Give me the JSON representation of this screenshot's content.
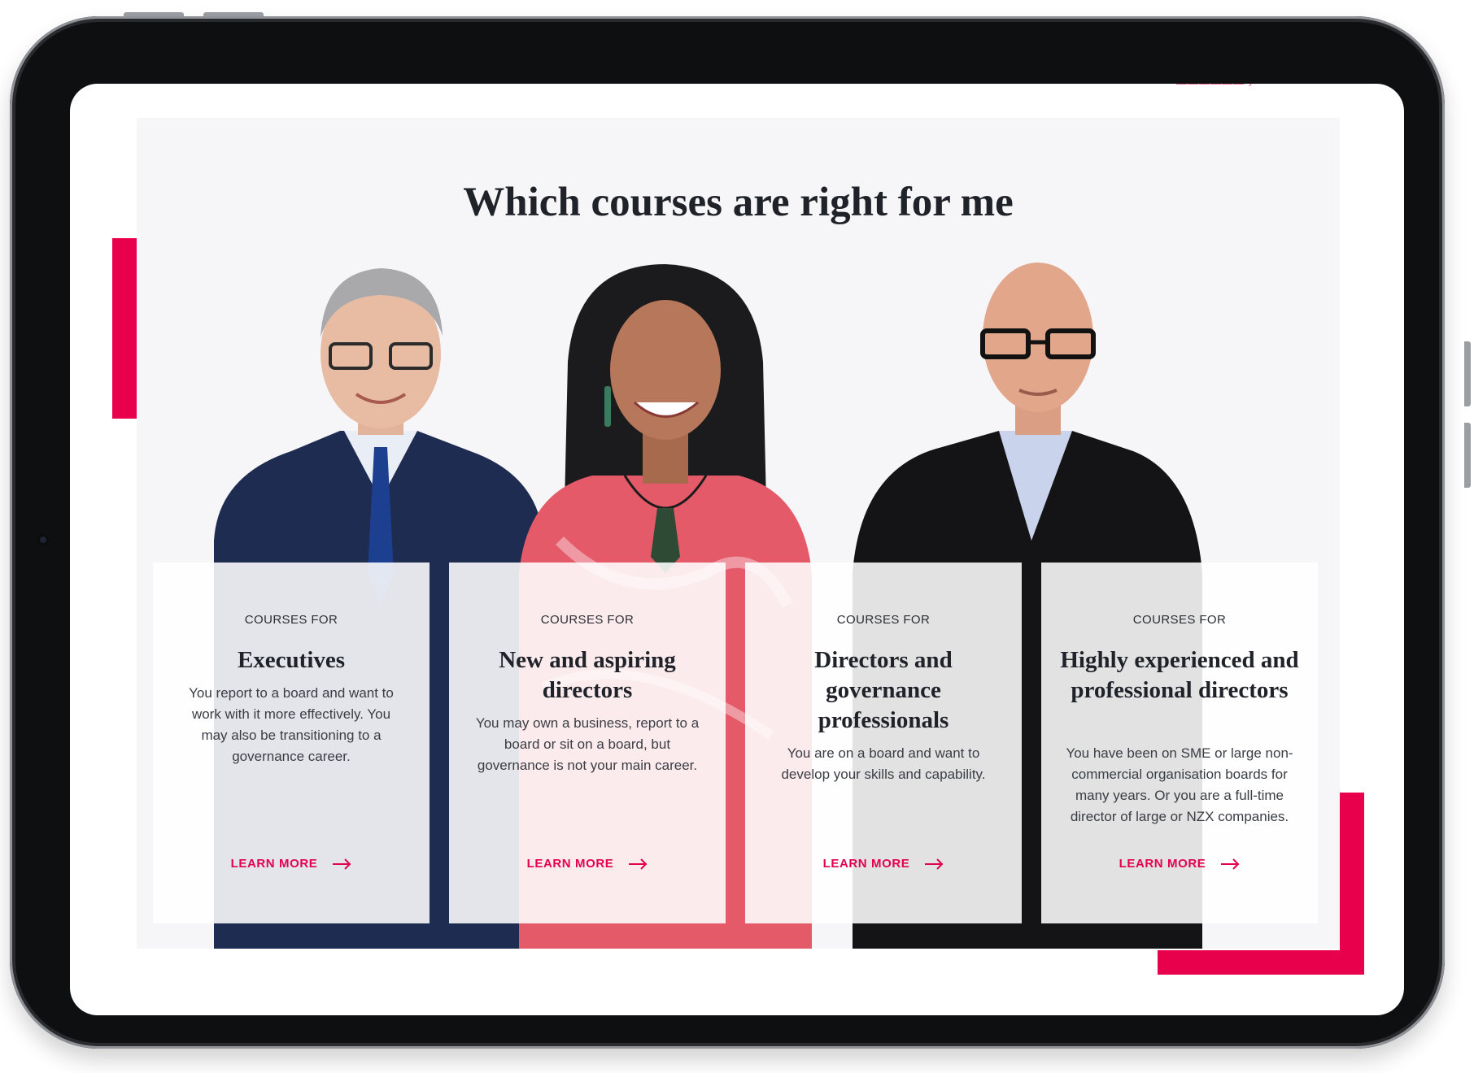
{
  "section": {
    "title": "Which courses are right for me"
  },
  "cards": [
    {
      "eyebrow": "COURSES FOR",
      "title": "Executives",
      "text": "You report to a board and want to work with it more effectively. You may also be transitioning to a governance career.",
      "link": "LEARN MORE"
    },
    {
      "eyebrow": "COURSES FOR",
      "title": "New and aspiring directors",
      "text": "You may own a business, report to a board or sit on a board, but governance is not your main career.",
      "link": "LEARN MORE"
    },
    {
      "eyebrow": "COURSES FOR",
      "title": "Directors and governance professionals",
      "text": "You are on a board and want to develop your skills and capability.",
      "link": "LEARN MORE"
    },
    {
      "eyebrow": "COURSES FOR",
      "title": "Highly experienced and professional directors",
      "text": "You have been on SME or large non-commercial organisation boards for many years. Or you are a full-time director of large or NZX companies.",
      "link": "LEARN MORE"
    }
  ],
  "colors": {
    "accent": "#e8004c",
    "section_background": "#f6f6f8",
    "heading": "#1f2229"
  },
  "icons": [
    "arrow-right-icon"
  ]
}
